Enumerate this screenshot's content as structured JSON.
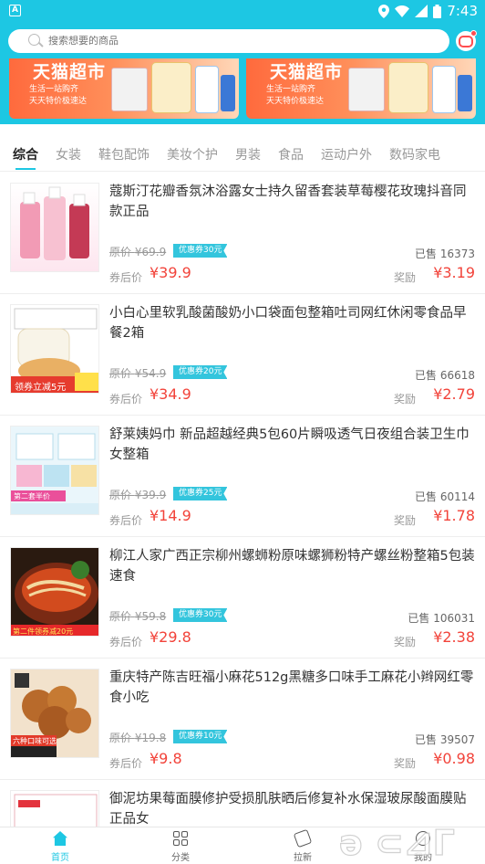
{
  "status_bar": {
    "time": "7:43"
  },
  "search": {
    "placeholder": "搜索想要的商品"
  },
  "banners": [
    {
      "title": "天猫超市",
      "line1": "生活一站购齐",
      "line2": "天天特价极速达"
    },
    {
      "title": "天猫超市",
      "line1": "生活一站购齐",
      "line2": "天天特价极速达"
    }
  ],
  "tabs": [
    "综合",
    "女装",
    "鞋包配饰",
    "美妆个护",
    "男装",
    "食品",
    "运动户外",
    "数码家电"
  ],
  "labels": {
    "orig_prefix": "原价",
    "after_coupon": "券后价",
    "sold_prefix": "已售",
    "reward": "奖励"
  },
  "products": [
    {
      "title": "蔻斯汀花瓣香氛沐浴露女士持久留香套装草莓樱花玫瑰抖音同款正品",
      "orig_price": "¥69.9",
      "coupon": "优惠券30元",
      "sold": "16373",
      "price": "¥39.9",
      "reward": "¥3.19",
      "thumb_text": ""
    },
    {
      "title": "小白心里软乳酸菌酸奶小口袋面包整箱吐司网红休闲零食品早餐2箱",
      "orig_price": "¥54.9",
      "coupon": "优惠券20元",
      "sold": "66618",
      "price": "¥34.9",
      "reward": "¥2.79",
      "thumb_text": "领券立减5元"
    },
    {
      "title": "舒莱姨妈巾 新品超越经典5包60片瞬吸透气日夜组合装卫生巾女整箱",
      "orig_price": "¥39.9",
      "coupon": "优惠券25元",
      "sold": "60114",
      "price": "¥14.9",
      "reward": "¥1.78",
      "thumb_text": "第二套半价"
    },
    {
      "title": "柳江人家广西正宗柳州螺蛳粉原味螺狮粉特产螺丝粉整箱5包装速食",
      "orig_price": "¥59.8",
      "coupon": "优惠券30元",
      "sold": "106031",
      "price": "¥29.8",
      "reward": "¥2.38",
      "thumb_text": "第二件领券减20元"
    },
    {
      "title": "重庆特产陈吉旺福小麻花512g黑糖多口味手工麻花小辫网红零食小吃",
      "orig_price": "¥19.8",
      "coupon": "优惠券10元",
      "sold": "39507",
      "price": "¥9.8",
      "reward": "¥0.98",
      "thumb_text": "六种口味可选"
    },
    {
      "title": "御泥坊果莓面膜修护受损肌肤晒后修复补水保湿玻尿酸面膜贴正品女",
      "orig_price": "",
      "coupon": "",
      "sold": "",
      "price": "",
      "reward": "",
      "thumb_text": ""
    }
  ],
  "bottom_nav": [
    {
      "label": "首页",
      "icon": "home-icon",
      "active": true
    },
    {
      "label": "分类",
      "icon": "category-icon",
      "active": false
    },
    {
      "label": "拉新",
      "icon": "invite-icon",
      "active": false
    },
    {
      "label": "我的",
      "icon": "profile-icon",
      "active": false
    }
  ],
  "colors": {
    "accent": "#1dc7e3",
    "price": "#f2433a",
    "coupon": "#33c5dd"
  }
}
